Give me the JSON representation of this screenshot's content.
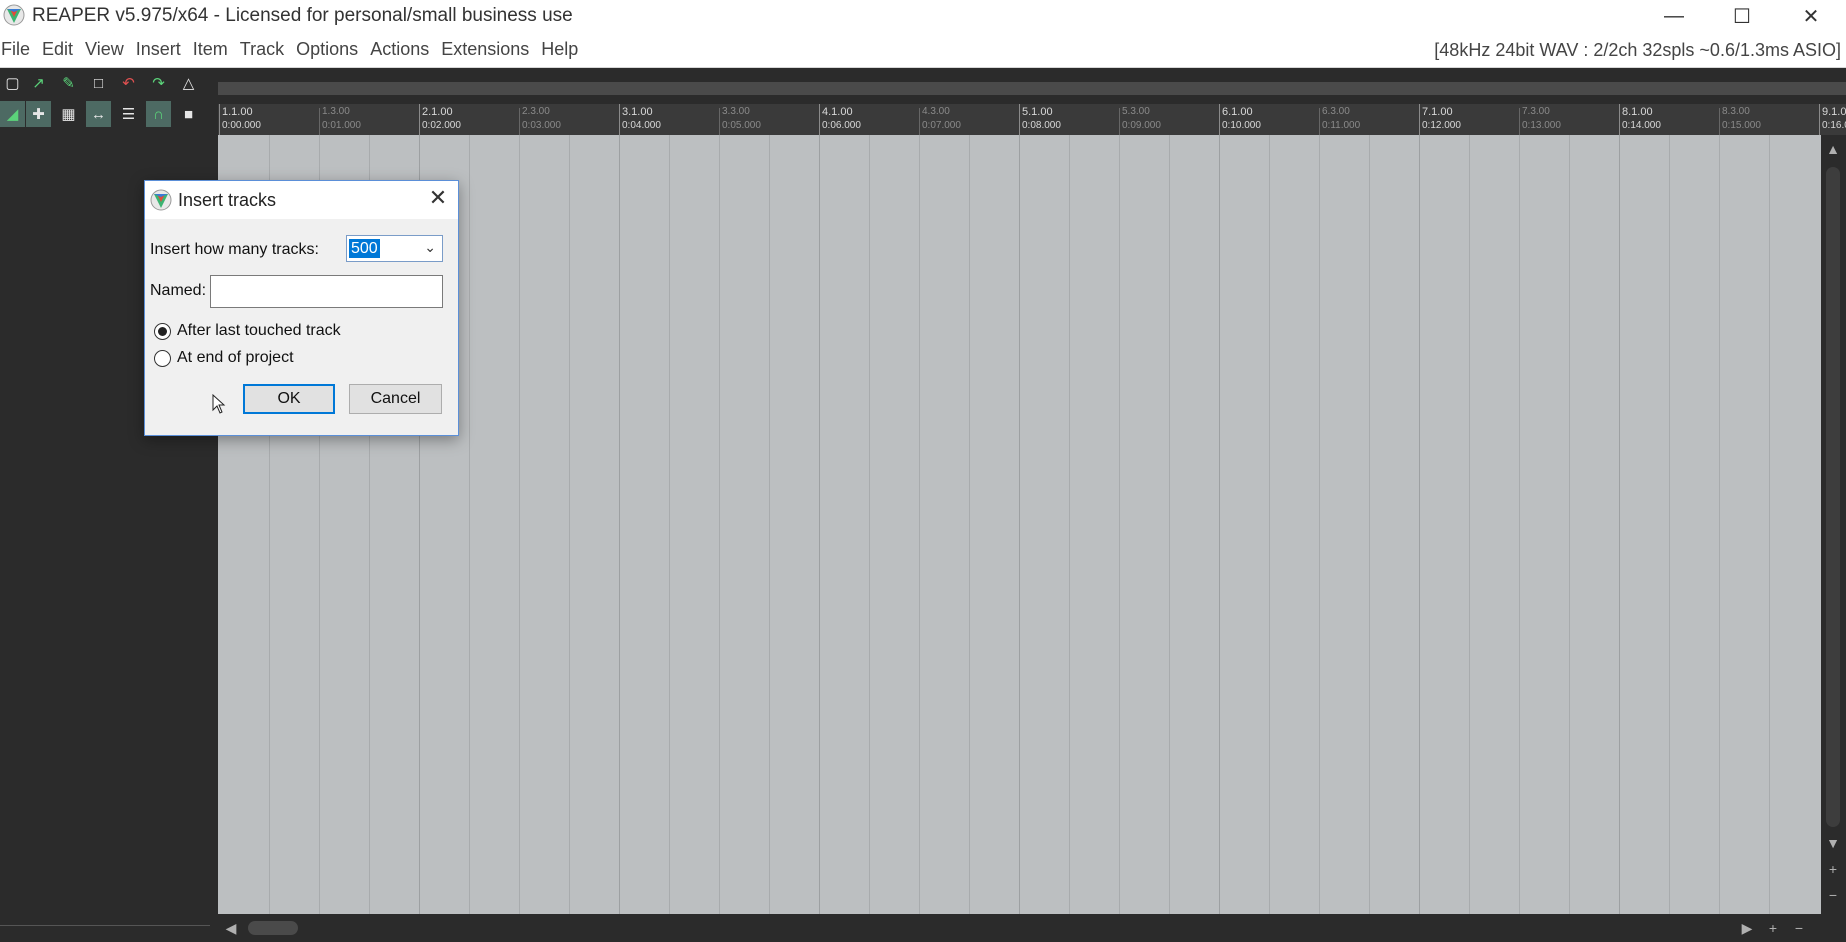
{
  "window": {
    "title": "REAPER v5.975/x64 - Licensed for personal/small business use",
    "minimize_glyph": "—",
    "maximize_glyph": "☐",
    "close_glyph": "✕"
  },
  "menu": {
    "items": [
      "File",
      "Edit",
      "View",
      "Insert",
      "Item",
      "Track",
      "Options",
      "Actions",
      "Extensions",
      "Help"
    ],
    "audio_status": "[48kHz 24bit WAV : 2/2ch 32spls ~0.6/1.3ms ASIO]"
  },
  "toolbar": {
    "icons": [
      "new-project-icon",
      "save-project-icon",
      "project-settings-icon",
      "undo-history-icon",
      "undo-icon",
      "redo-icon",
      "metronome-icon",
      "auto-crossfade-icon",
      "ripple-edit-icon",
      "grid-icon",
      "snap-icon",
      "envelope-icon",
      "magnet-icon",
      "lock-icon"
    ]
  },
  "ruler": {
    "major": [
      {
        "bar": "1.1.00",
        "time": "0:00.000"
      },
      {
        "bar": "2.1.00",
        "time": "0:02.000"
      },
      {
        "bar": "3.1.00",
        "time": "0:04.000"
      },
      {
        "bar": "4.1.00",
        "time": "0:06.000"
      },
      {
        "bar": "5.1.00",
        "time": "0:08.000"
      },
      {
        "bar": "6.1.00",
        "time": "0:10.000"
      },
      {
        "bar": "7.1.00",
        "time": "0:12.000"
      },
      {
        "bar": "8.1.00",
        "time": "0:14.000"
      },
      {
        "bar": "9.1.0",
        "time": "0:16.0"
      }
    ],
    "minor": [
      {
        "bar": "1.3.00",
        "time": "0:01.000"
      },
      {
        "bar": "2.3.00",
        "time": "0:03.000"
      },
      {
        "bar": "3.3.00",
        "time": "0:05.000"
      },
      {
        "bar": "4.3.00",
        "time": "0:07.000"
      },
      {
        "bar": "5.3.00",
        "time": "0:09.000"
      },
      {
        "bar": "6.3.00",
        "time": "0:11.000"
      },
      {
        "bar": "7.3.00",
        "time": "0:13.000"
      },
      {
        "bar": "8.3.00",
        "time": "0:15.000"
      }
    ]
  },
  "dialog": {
    "title": "Insert tracks",
    "close_glyph": "✕",
    "count_label": "Insert how many tracks:",
    "count_value": "500",
    "name_label": "Named:",
    "name_value": "",
    "option_after": "After last touched track",
    "option_end": "At end of project",
    "selected_option": "after",
    "ok_label": "OK",
    "cancel_label": "Cancel"
  },
  "colors": {
    "arrange_bg": "#bcbfc1",
    "panel_bg": "#2b2b2b",
    "accent": "#0078d7"
  }
}
